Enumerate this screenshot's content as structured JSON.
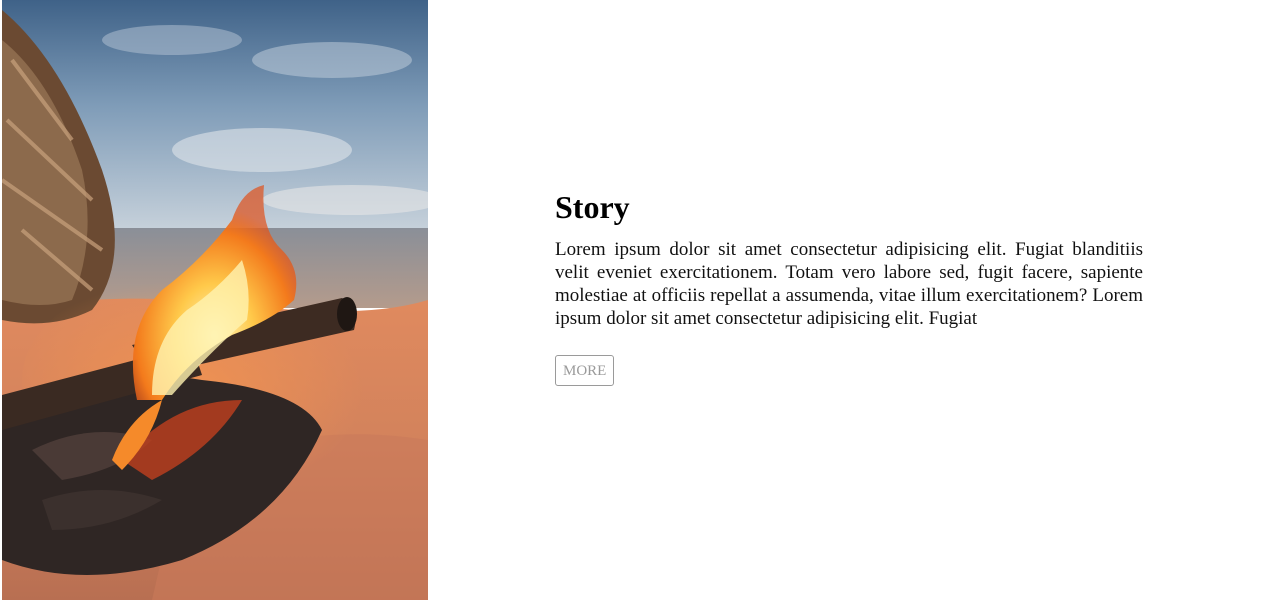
{
  "hero_image": {
    "subject": "campfire-on-beach"
  },
  "story": {
    "title": "Story",
    "body": "Lorem ipsum dolor sit amet consectetur adipisicing elit. Fugiat blanditiis velit eveniet exercitationem. Totam vero labore sed, fugit facere, sapiente molestiae at officiis repellat a assumenda, vitae illum exercitationem? Lorem ipsum dolor sit amet consectetur adipisicing elit. Fugiat",
    "more_label": "MORE"
  },
  "colors": {
    "title": "#000000",
    "button_border": "#9a9a9a",
    "button_text": "#9a9a9a"
  }
}
